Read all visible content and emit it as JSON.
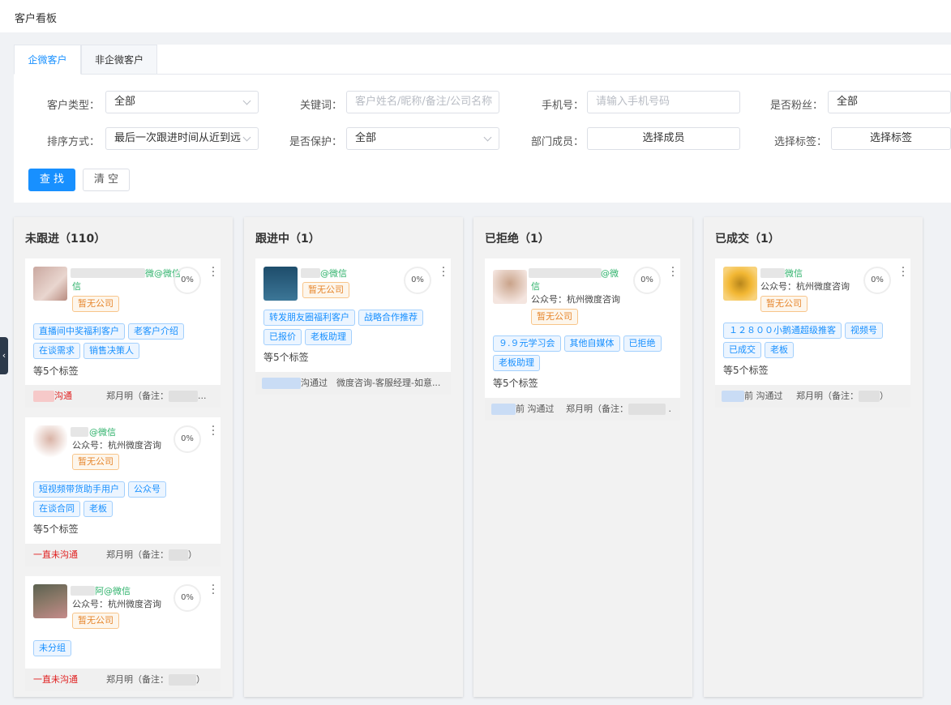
{
  "page": {
    "title": "客户看板"
  },
  "tabs": [
    {
      "label": "企微客户",
      "active": true
    },
    {
      "label": "非企微客户",
      "active": false
    }
  ],
  "filters": {
    "customer_type": {
      "label": "客户类型：",
      "value": "全部"
    },
    "keyword": {
      "label": "关键词：",
      "placeholder": "客户姓名/昵称/备注/公司名称"
    },
    "phone": {
      "label": "手机号：",
      "placeholder": "请输入手机号码"
    },
    "is_fan": {
      "label": "是否粉丝：",
      "value": "全部"
    },
    "sort": {
      "label": "排序方式：",
      "value": "最后一次跟进时间从近到远"
    },
    "protected": {
      "label": "是否保护：",
      "value": "全部"
    },
    "members": {
      "label": "部门成员：",
      "value": "选择成员"
    },
    "tags": {
      "label": "选择标签：",
      "value": "选择标签"
    }
  },
  "buttons": {
    "search": "查 找",
    "clear": "清 空"
  },
  "columns": [
    {
      "title": "未跟进（110）",
      "cards": [
        {
          "name": "微@微信",
          "name_tail": "信",
          "sub": "",
          "company": "暂无公司",
          "percent": "0%",
          "tags": [
            "直播间中奖福利客户",
            "老客户介绍",
            "在谈需求",
            "销售决策人"
          ],
          "more_tags": "等5个标签",
          "status": "沟通",
          "owner": "郑月明（备注："
        },
        {
          "name": "@微信",
          "sub": "公众号：杭州微度咨询",
          "company": "暂无公司",
          "percent": "0%",
          "tags": [
            "短视频带货助手用户",
            "公众号",
            "在谈合同",
            "老板"
          ],
          "more_tags": "等5个标签",
          "status": "一直未沟通",
          "owner": "郑月明（备注："
        },
        {
          "name": "阿@微信",
          "sub": "公众号：杭州微度咨询",
          "company": "暂无公司",
          "percent": "0%",
          "tags": [
            "未分组"
          ],
          "more_tags": "",
          "status": "一直未沟通",
          "owner": "郑月明（备注："
        }
      ]
    },
    {
      "title": "跟进中（1）",
      "cards": [
        {
          "name": "@微信",
          "sub": "",
          "company": "暂无公司",
          "percent": "0%",
          "tags": [
            "转发朋友圈福利客户",
            "战略合作推荐",
            "已报价",
            "老板助理"
          ],
          "more_tags": "等5个标签",
          "status": "沟通过",
          "owner": "微度咨询-客服经理-如意..."
        }
      ]
    },
    {
      "title": "已拒绝（1）",
      "cards": [
        {
          "name": "@微",
          "name_tail": "信",
          "sub": "公众号：杭州微度咨询",
          "company": "暂无公司",
          "percent": "0%",
          "tags": [
            "９.９元学习会",
            "其他自媒体",
            "已拒绝",
            "老板助理"
          ],
          "more_tags": "等5个标签",
          "status": "前 沟通过",
          "owner": "郑月明（备注："
        }
      ]
    },
    {
      "title": "已成交（1）",
      "cards": [
        {
          "name": "微信",
          "sub": "公众号：杭州微度咨询",
          "company": "暂无公司",
          "percent": "0%",
          "tags": [
            "１２８００小鹅通超级推客",
            "视频号",
            "已成交",
            "老板"
          ],
          "more_tags": "等5个标签",
          "status": "前 沟通过",
          "owner": "郑月明（备注："
        }
      ]
    }
  ],
  "colors": {
    "accent": "#1890ff",
    "wechat_green": "#2fb26b",
    "company_orange": "#e6862c",
    "status_red": "#e02020"
  }
}
